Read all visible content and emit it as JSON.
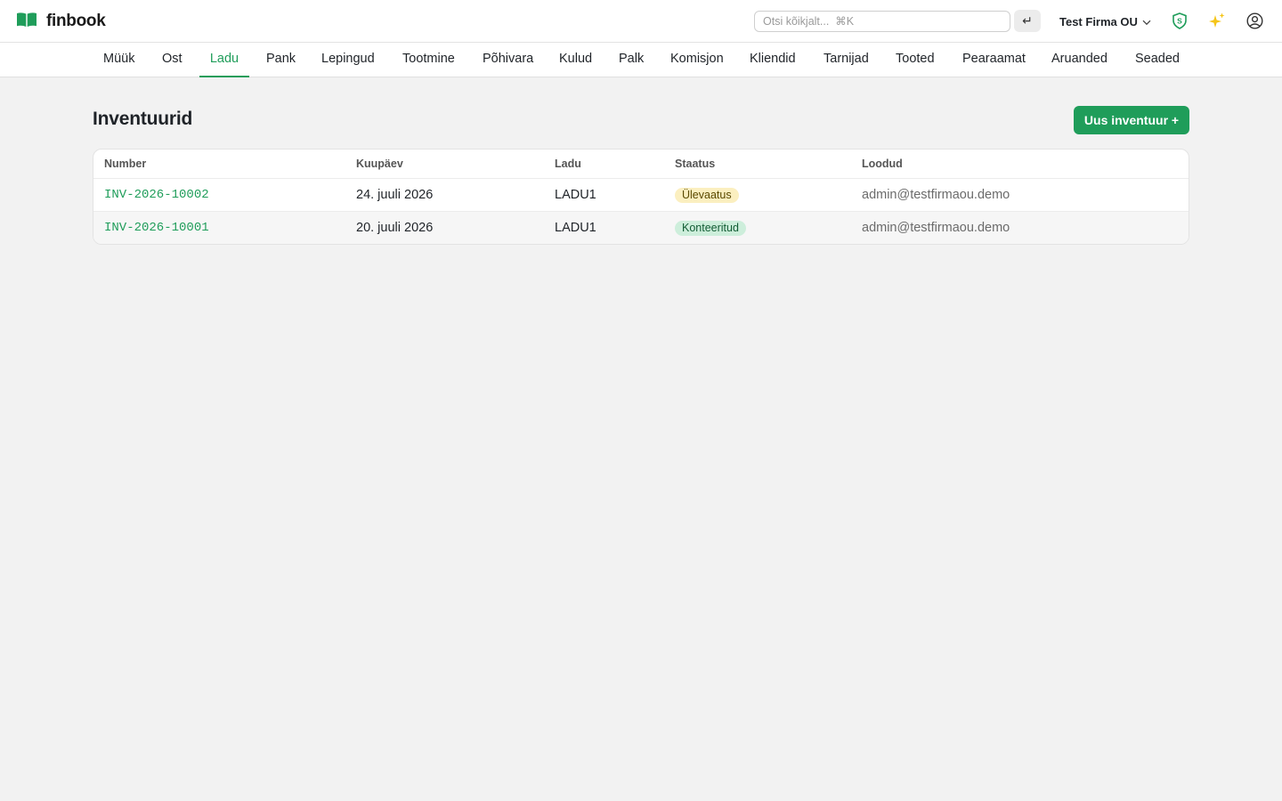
{
  "app": {
    "name": "finbook"
  },
  "header": {
    "search_placeholder": "Otsi kõikjalt...  ⌘K",
    "enter_symbol": "↵",
    "company": "Test Firma OU",
    "company_chevron": "⌵"
  },
  "nav": {
    "items": [
      {
        "label": "Müük"
      },
      {
        "label": "Ost"
      },
      {
        "label": "Ladu",
        "active": true
      },
      {
        "label": "Pank"
      },
      {
        "label": "Lepingud"
      },
      {
        "label": "Tootmine"
      },
      {
        "label": "Põhivara"
      },
      {
        "label": "Kulud"
      },
      {
        "label": "Palk"
      },
      {
        "label": "Komisjon"
      },
      {
        "label": "Kliendid"
      },
      {
        "label": "Tarnijad"
      },
      {
        "label": "Tooted"
      },
      {
        "label": "Pearaamat"
      },
      {
        "label": "Aruanded"
      },
      {
        "label": "Seaded"
      }
    ]
  },
  "page": {
    "title": "Inventuurid",
    "new_button": "Uus inventuur +"
  },
  "table": {
    "columns": [
      "Number",
      "Kuupäev",
      "Ladu",
      "Staatus",
      "Loodud"
    ],
    "rows": [
      {
        "number": "INV-2026-10002",
        "date": "24. juuli 2026",
        "warehouse": "LADU1",
        "status": "Ülevaatus",
        "created_by": "admin@testfirmaou.demo"
      },
      {
        "number": "INV-2026-10001",
        "date": "20. juuli 2026",
        "warehouse": "LADU1",
        "status": "Konteeritud",
        "created_by": "admin@testfirmaou.demo"
      }
    ]
  },
  "colors": {
    "accent": "#1f9d5a",
    "badge_review": "#fbefc0",
    "badge_posted": "#cdeedb"
  },
  "icons": [
    "book-logo-icon",
    "shield-s-icon",
    "sparkles-icon",
    "user-circle-icon"
  ]
}
